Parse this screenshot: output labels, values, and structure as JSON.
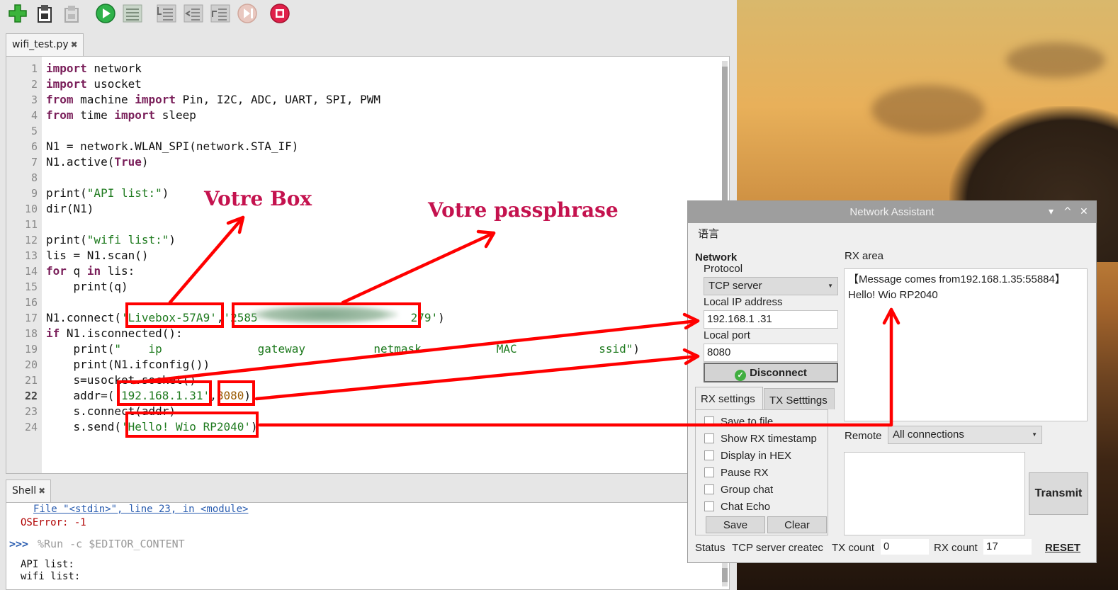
{
  "editor": {
    "tab_name": "wifi_test.py",
    "tab_close": "✖",
    "line_numbers": [
      "1",
      "2",
      "3",
      "4",
      "5",
      "6",
      "7",
      "8",
      "9",
      "10",
      "11",
      "12",
      "13",
      "14",
      "15",
      "16",
      "17",
      "18",
      "19",
      "20",
      "21",
      "22",
      "23",
      "24"
    ],
    "lines": {
      "l1_kw": "import",
      "l1_rest": " network",
      "l2_kw": "import",
      "l2_rest": " usocket",
      "l3_kw1": "from",
      "l3_mid": " machine ",
      "l3_kw2": "import",
      "l3_rest": " Pin, I2C, ADC, UART, SPI, PWM",
      "l4_kw1": "from",
      "l4_mid": " time ",
      "l4_kw2": "import",
      "l4_rest": " sleep",
      "l6": "N1 = network.WLAN_SPI(network.STA_IF)",
      "l7_a": "N1.active(",
      "l7_kw": "True",
      "l7_b": ")",
      "l9_a": "print(",
      "l9_str": "\"API list:\"",
      "l9_b": ")",
      "l10": "dir(N1)",
      "l12_a": "print(",
      "l12_str": "\"wifi list:\"",
      "l12_b": ")",
      "l13": "lis = N1.scan()",
      "l14_kw1": "for",
      "l14_mid": " q ",
      "l14_kw2": "in",
      "l14_rest": " lis:",
      "l15": "    print(q)",
      "l17_a": "N1.connect(",
      "l17_s1": "'Livebox-57A9'",
      "l17_c": ",",
      "l17_s2a": "'2585",
      "l17_s2b": "279'",
      "l17_b": ")",
      "l18_kw": "if",
      "l18_rest": " N1.isconnected():",
      "l19_a": "    print(",
      "l19_str": "\"    ip              gateway          netmask           MAC            ssid\"",
      "l19_b": ")",
      "l20": "    print(N1.ifconfig())",
      "l21": "    s=usocket.socket()",
      "l22_a": "    addr=(",
      "l22_str": "'192.168.1.31'",
      "l22_c": ",",
      "l22_num": "8080",
      "l22_b": ")",
      "l23": "    s.connect(addr)",
      "l24_a": "    s.send(",
      "l24_str": "'Hello! Wio RP2040'",
      "l24_b": ")"
    }
  },
  "shell": {
    "tab_name": "Shell",
    "tab_close": "✖",
    "trace_line": "File \"<stdin>\", line 23, in <module>",
    "error": "OSError: -1",
    "prompt": ">>>",
    "command": "%Run -c $EDITOR_CONTENT",
    "out1": "API list:",
    "out2": "wifi list:"
  },
  "annotations": {
    "box_label": "Votre Box",
    "pass_label": "Votre passphrase"
  },
  "net_assistant": {
    "title": "Network Assistant",
    "menu_lang": "语言",
    "network_heading": "Network",
    "protocol_label": "Protocol",
    "protocol_value": "TCP server",
    "local_ip_label": "Local IP address",
    "local_ip_value": "192.168.1  .31",
    "local_port_label": "Local port",
    "local_port_value": "8080",
    "disconnect_label": "Disconnect",
    "tab_rx": "RX settings",
    "tab_tx": "TX Setttings",
    "rx_options": [
      "Save to file",
      "Show RX timestamp",
      "Display in HEX",
      "Pause RX",
      "Group chat",
      "Chat Echo"
    ],
    "save_label": "Save",
    "clear_label": "Clear",
    "rx_area_label": "RX area",
    "rx_line1": "【Message comes from192.168.1.35:55884】",
    "rx_line2": "Hello! Wio RP2040",
    "remote_label": "Remote",
    "remote_value": "All connections",
    "transmit_label": "Transmit",
    "status_label": "Status",
    "status_value": "TCP server createc",
    "tx_count_label": "TX count",
    "tx_count_value": "0",
    "rx_count_label": "RX count",
    "rx_count_value": "17",
    "reset_label": "RESET"
  },
  "colors": {
    "annotation_red": "#ff0000",
    "annotation_text": "#c4124e",
    "keyword": "#7a1f5a",
    "string": "#1e7a1e"
  }
}
